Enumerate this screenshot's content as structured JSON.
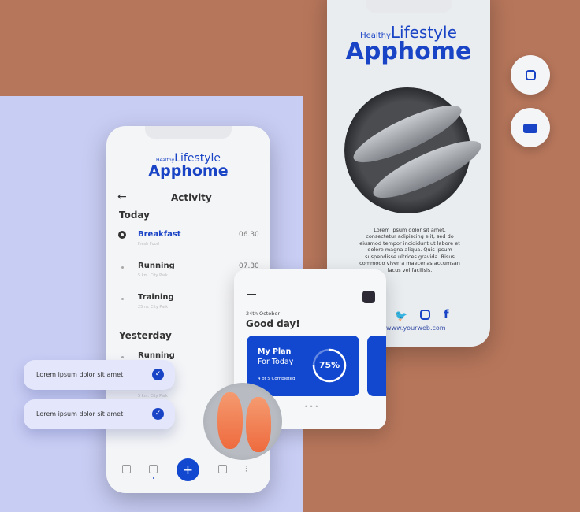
{
  "brand": {
    "small": "Healthy",
    "lifestyle": "Lifestyle",
    "name": "Apphome"
  },
  "activity": {
    "title": "Activity",
    "today": "Today",
    "yesterday": "Yesterday",
    "items": [
      {
        "name": "Breakfast",
        "sub": "Fresh Food",
        "time": "06.30"
      },
      {
        "name": "Running",
        "sub": "5 km. City Park",
        "time": "07.30"
      },
      {
        "name": "Training",
        "sub": "25 m. City Park",
        "time": ""
      }
    ],
    "yesterday_items": [
      {
        "name": "Running",
        "sub": ""
      },
      {
        "name": "",
        "sub": "5 km. City Park"
      }
    ]
  },
  "pills": [
    "Lorem ipsum dolor sit amet",
    "Lorem ipsum dolor sit amet"
  ],
  "card": {
    "date": "24th October",
    "greeting": "Good day!",
    "plan_title": "My Plan",
    "plan_sub": "For Today",
    "progress": 75,
    "progress_label": "75%",
    "completed": "4 of 5 Completed"
  },
  "poster": {
    "body": "Lorem ipsum dolor sit amet, consectetur adipiscing elit, sed do eiusmod tempor incididunt ut labore et dolore magna aliqua. Quis ipsum suspendisse ultrices gravida. Risus commodo viverra maecenas accumsan lacus vel facilisis.",
    "url": "www.yourweb.com"
  },
  "colors": {
    "accent": "#1248d0",
    "background": "#b6765b",
    "panel": "#c8cdf4"
  }
}
